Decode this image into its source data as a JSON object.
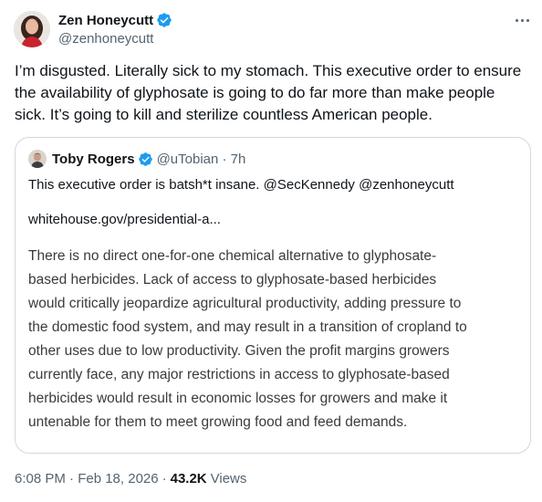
{
  "author": {
    "name": "Zen Honeycutt",
    "handle": "@zenhoneycutt"
  },
  "tweet_text": "I’m disgusted. Literally sick to my stomach. This executive order to ensure the availability of glyphosate is going to do far more than make people sick. It’s going to kill and sterilize countless American people.",
  "quote": {
    "name": "Toby Rogers",
    "handle": "@uTobian · 7h",
    "text": "This executive order is batsh*t insane. @SecKennedy @zenhoneycutt",
    "link": "whitehouse.gov/presidential-a...",
    "image_lines": [
      "There is no direct one-for-one chemical alternative to glyphosate-",
      "based herbicides.  Lack of access to glyphosate-based herbicides",
      "would critically jeopardize agricultural productivity, adding pressure to",
      "the domestic food system, and may result in a transition of cropland to",
      "other uses due to low productivity.  Given the profit margins growers",
      "currently face, any major restrictions in access to glyphosate-based",
      "herbicides would result in economic losses for growers and make it",
      "untenable for them to meet growing food and feed demands."
    ]
  },
  "meta": {
    "time": "6:08 PM · Feb 18, 2026",
    "sep": "·",
    "views_count": "43.2K",
    "views_label": "Views"
  },
  "colors": {
    "verified": "#1d9bf0",
    "secondary_text": "#536471",
    "border": "#cfd9de"
  },
  "icons": {
    "verified": "verified-badge-icon",
    "more": "more-options-icon"
  }
}
